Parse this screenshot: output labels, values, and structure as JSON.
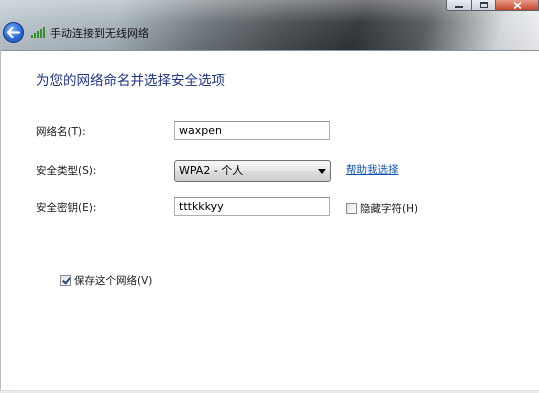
{
  "window": {
    "title": "手动连接到无线网络"
  },
  "icons": {
    "back": "back-arrow-icon",
    "wifi": "wireless-signal-icon"
  },
  "colors": {
    "heading": "#1e3287",
    "link": "#0f52b8",
    "back_button": "#2b6bd6",
    "close_button": "#c5482c"
  },
  "form": {
    "heading": "为您的网络命名并选择安全选项",
    "network_name": {
      "label": "网络名(T):",
      "value": "waxpen"
    },
    "security_type": {
      "label": "安全类型(S):",
      "selected": "WPA2 - 个人",
      "help_link": "帮助我选择"
    },
    "security_key": {
      "label": "安全密钥(E):",
      "value": "tttkkkyy",
      "hide_chars_label": "隐藏字符(H)",
      "hide_chars_checked": false
    },
    "save_network": {
      "label": "保存这个网络(V)",
      "checked": true
    }
  }
}
